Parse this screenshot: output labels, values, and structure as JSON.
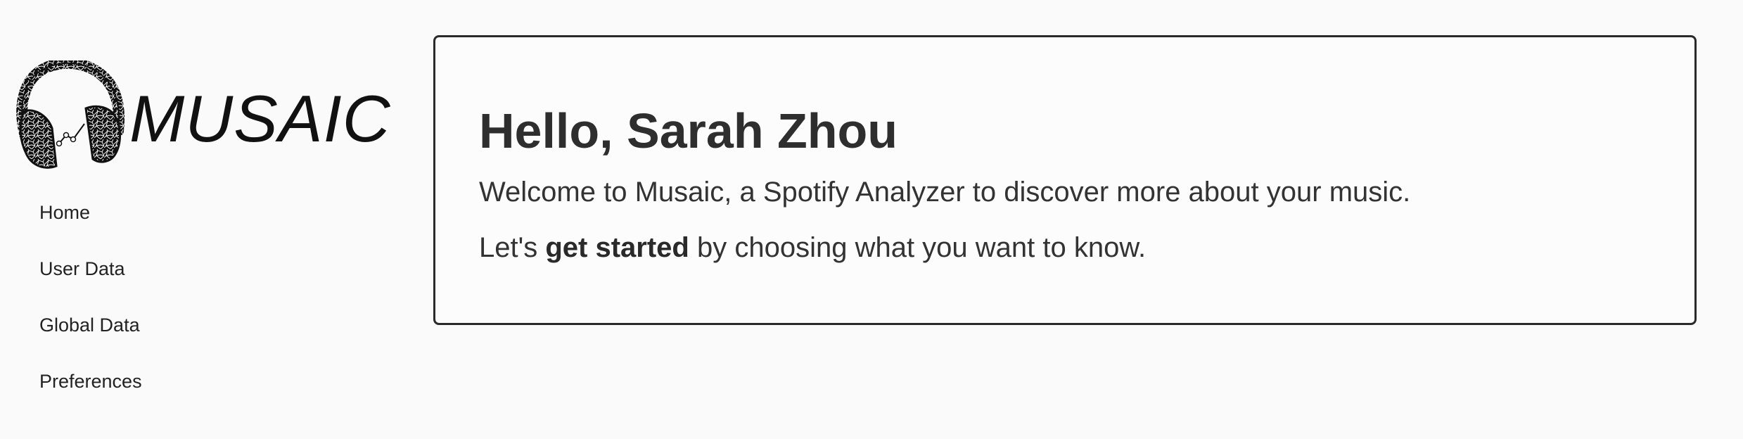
{
  "brand": {
    "name": "MUSAIC",
    "icon": "headphones-mosaic-icon"
  },
  "sidebar": {
    "items": [
      {
        "label": "Home"
      },
      {
        "label": "User Data"
      },
      {
        "label": "Global Data"
      },
      {
        "label": "Preferences"
      }
    ]
  },
  "main": {
    "greeting": "Hello, Sarah Zhou",
    "welcome": "Welcome to Musaic, a Spotify Analyzer to discover more about your music.",
    "cta_prefix": "Let's ",
    "cta_emphasis": "get started",
    "cta_suffix": " by choosing what you want to know."
  },
  "colors": {
    "background": "#fafafa",
    "text": "#2b2b2b",
    "card_border": "#2a2a2a"
  }
}
